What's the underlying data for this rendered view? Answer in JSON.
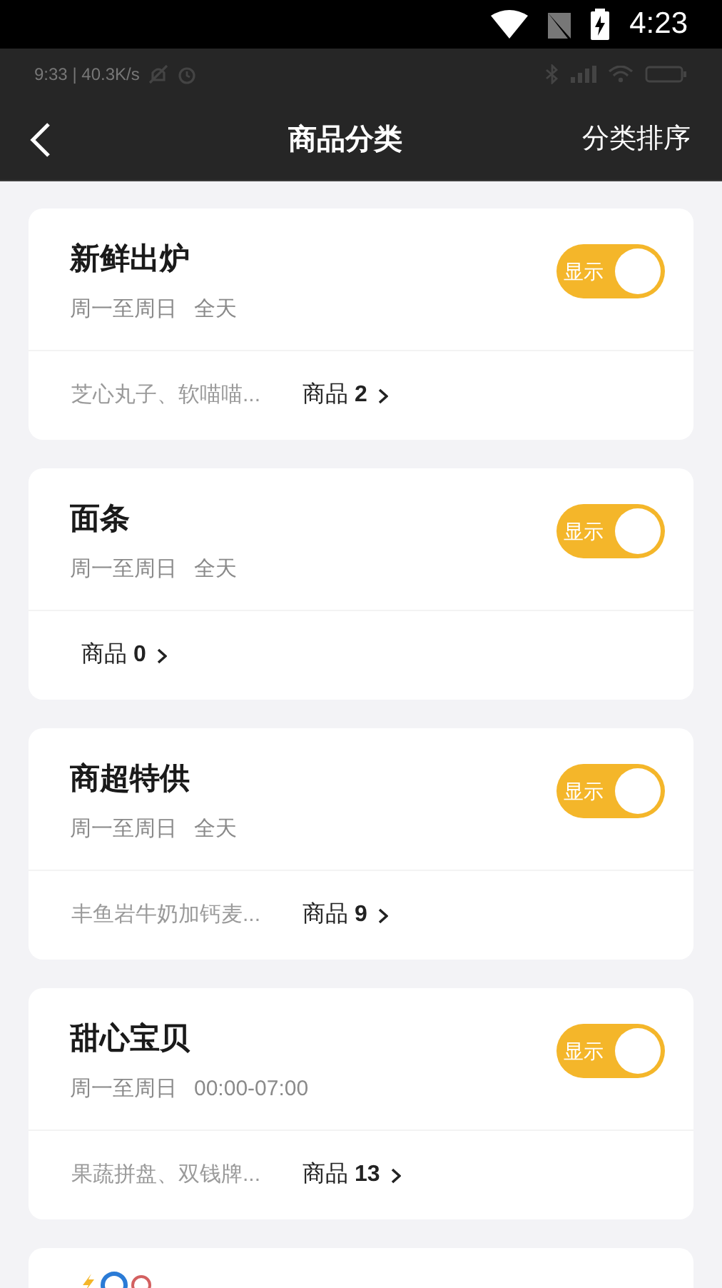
{
  "status_bar": {
    "time": "4:23"
  },
  "system_bar": {
    "text": "9:33 | 40.3K/s"
  },
  "header": {
    "title": "商品分类",
    "action": "分类排序"
  },
  "categories": [
    {
      "name": "新鲜出炉",
      "days": "周一至周日",
      "hours": "全天",
      "preview": "芝心丸子、软喵喵...",
      "goods": "商品 **2**",
      "toggle": {
        "label": "显示",
        "on": true
      }
    },
    {
      "name": "面条",
      "days": "周一至周日",
      "hours": "全天",
      "goods": "商品 **0**",
      "toggle": {
        "label": "显示",
        "on": true
      }
    },
    {
      "name": "商超特供",
      "days": "周一至周日",
      "hours": "全天",
      "preview": "丰鱼岩牛奶加钙麦...",
      "goods": "商品 **9**",
      "toggle": {
        "label": "显示",
        "on": true
      }
    },
    {
      "name": "甜心宝贝",
      "days": "周一至周日",
      "hours": "00:00-07:00",
      "preview": "果蔬拼盘、双钱牌...",
      "goods": "商品 **13**",
      "toggle": {
        "label": "显示",
        "on": true
      }
    }
  ]
}
